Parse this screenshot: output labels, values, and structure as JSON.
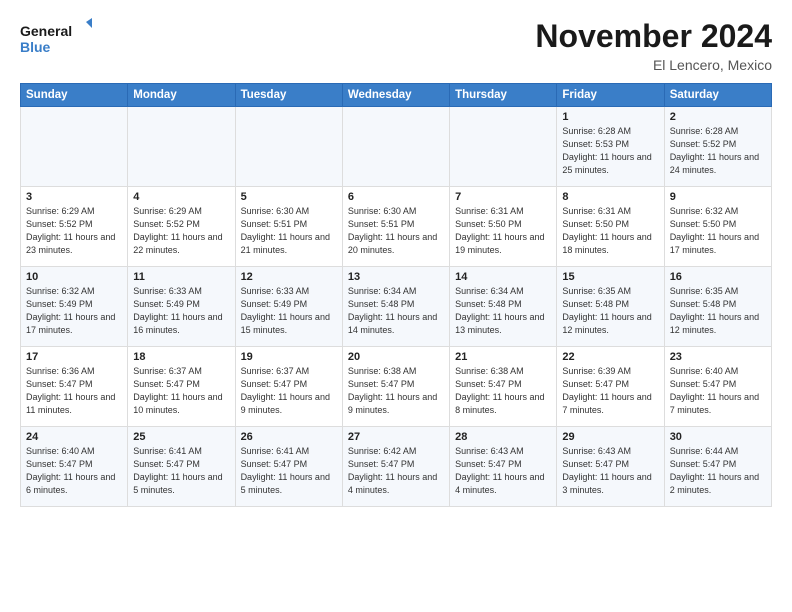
{
  "logo": {
    "line1": "General",
    "line2": "Blue"
  },
  "title": "November 2024",
  "subtitle": "El Lencero, Mexico",
  "weekdays": [
    "Sunday",
    "Monday",
    "Tuesday",
    "Wednesday",
    "Thursday",
    "Friday",
    "Saturday"
  ],
  "weeks": [
    [
      {
        "day": "",
        "info": ""
      },
      {
        "day": "",
        "info": ""
      },
      {
        "day": "",
        "info": ""
      },
      {
        "day": "",
        "info": ""
      },
      {
        "day": "",
        "info": ""
      },
      {
        "day": "1",
        "info": "Sunrise: 6:28 AM\nSunset: 5:53 PM\nDaylight: 11 hours and 25 minutes."
      },
      {
        "day": "2",
        "info": "Sunrise: 6:28 AM\nSunset: 5:52 PM\nDaylight: 11 hours and 24 minutes."
      }
    ],
    [
      {
        "day": "3",
        "info": "Sunrise: 6:29 AM\nSunset: 5:52 PM\nDaylight: 11 hours and 23 minutes."
      },
      {
        "day": "4",
        "info": "Sunrise: 6:29 AM\nSunset: 5:52 PM\nDaylight: 11 hours and 22 minutes."
      },
      {
        "day": "5",
        "info": "Sunrise: 6:30 AM\nSunset: 5:51 PM\nDaylight: 11 hours and 21 minutes."
      },
      {
        "day": "6",
        "info": "Sunrise: 6:30 AM\nSunset: 5:51 PM\nDaylight: 11 hours and 20 minutes."
      },
      {
        "day": "7",
        "info": "Sunrise: 6:31 AM\nSunset: 5:50 PM\nDaylight: 11 hours and 19 minutes."
      },
      {
        "day": "8",
        "info": "Sunrise: 6:31 AM\nSunset: 5:50 PM\nDaylight: 11 hours and 18 minutes."
      },
      {
        "day": "9",
        "info": "Sunrise: 6:32 AM\nSunset: 5:50 PM\nDaylight: 11 hours and 17 minutes."
      }
    ],
    [
      {
        "day": "10",
        "info": "Sunrise: 6:32 AM\nSunset: 5:49 PM\nDaylight: 11 hours and 17 minutes."
      },
      {
        "day": "11",
        "info": "Sunrise: 6:33 AM\nSunset: 5:49 PM\nDaylight: 11 hours and 16 minutes."
      },
      {
        "day": "12",
        "info": "Sunrise: 6:33 AM\nSunset: 5:49 PM\nDaylight: 11 hours and 15 minutes."
      },
      {
        "day": "13",
        "info": "Sunrise: 6:34 AM\nSunset: 5:48 PM\nDaylight: 11 hours and 14 minutes."
      },
      {
        "day": "14",
        "info": "Sunrise: 6:34 AM\nSunset: 5:48 PM\nDaylight: 11 hours and 13 minutes."
      },
      {
        "day": "15",
        "info": "Sunrise: 6:35 AM\nSunset: 5:48 PM\nDaylight: 11 hours and 12 minutes."
      },
      {
        "day": "16",
        "info": "Sunrise: 6:35 AM\nSunset: 5:48 PM\nDaylight: 11 hours and 12 minutes."
      }
    ],
    [
      {
        "day": "17",
        "info": "Sunrise: 6:36 AM\nSunset: 5:47 PM\nDaylight: 11 hours and 11 minutes."
      },
      {
        "day": "18",
        "info": "Sunrise: 6:37 AM\nSunset: 5:47 PM\nDaylight: 11 hours and 10 minutes."
      },
      {
        "day": "19",
        "info": "Sunrise: 6:37 AM\nSunset: 5:47 PM\nDaylight: 11 hours and 9 minutes."
      },
      {
        "day": "20",
        "info": "Sunrise: 6:38 AM\nSunset: 5:47 PM\nDaylight: 11 hours and 9 minutes."
      },
      {
        "day": "21",
        "info": "Sunrise: 6:38 AM\nSunset: 5:47 PM\nDaylight: 11 hours and 8 minutes."
      },
      {
        "day": "22",
        "info": "Sunrise: 6:39 AM\nSunset: 5:47 PM\nDaylight: 11 hours and 7 minutes."
      },
      {
        "day": "23",
        "info": "Sunrise: 6:40 AM\nSunset: 5:47 PM\nDaylight: 11 hours and 7 minutes."
      }
    ],
    [
      {
        "day": "24",
        "info": "Sunrise: 6:40 AM\nSunset: 5:47 PM\nDaylight: 11 hours and 6 minutes."
      },
      {
        "day": "25",
        "info": "Sunrise: 6:41 AM\nSunset: 5:47 PM\nDaylight: 11 hours and 5 minutes."
      },
      {
        "day": "26",
        "info": "Sunrise: 6:41 AM\nSunset: 5:47 PM\nDaylight: 11 hours and 5 minutes."
      },
      {
        "day": "27",
        "info": "Sunrise: 6:42 AM\nSunset: 5:47 PM\nDaylight: 11 hours and 4 minutes."
      },
      {
        "day": "28",
        "info": "Sunrise: 6:43 AM\nSunset: 5:47 PM\nDaylight: 11 hours and 4 minutes."
      },
      {
        "day": "29",
        "info": "Sunrise: 6:43 AM\nSunset: 5:47 PM\nDaylight: 11 hours and 3 minutes."
      },
      {
        "day": "30",
        "info": "Sunrise: 6:44 AM\nSunset: 5:47 PM\nDaylight: 11 hours and 2 minutes."
      }
    ]
  ]
}
